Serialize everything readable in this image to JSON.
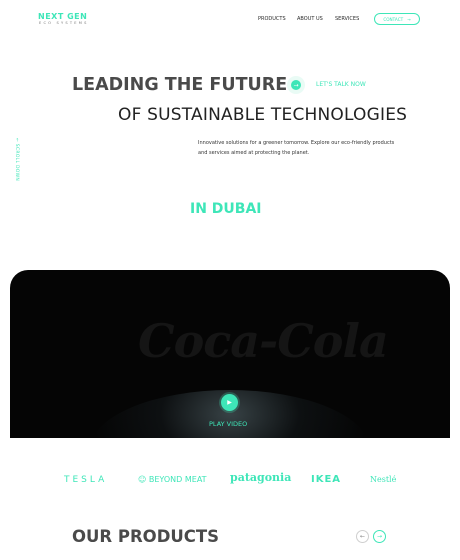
{
  "header": {
    "logo_main": "NEXT GEN",
    "logo_sub": "ECO SYSTEMS",
    "nav": [
      "PRODUCTS",
      "ABOUT US",
      "SERVICES"
    ],
    "contact_label": "CONTACT",
    "contact_icon": "→"
  },
  "hero": {
    "line1": "LEADING THE FUTURE",
    "cta_label": "LET'S TALK NOW",
    "cta_icon": "→",
    "line2": "OF SUSTAINABLE TECHNOLOGIES",
    "description": "Innovative solutions for a greener tomorrow. Explore our eco-friendly products and services aimed at protecting the planet.",
    "scroll_label": "← SCROLL DOWN",
    "location": "IN DUBAI"
  },
  "video": {
    "watermark": "Coca-Cola",
    "play_icon": "▶",
    "play_label": "PLAY VIDEO"
  },
  "brands": [
    "TESLA",
    "BEYOND MEAT",
    "patagonia",
    "IKEA",
    "Nestlé"
  ],
  "brand_icons": {
    "beyond": "☺"
  },
  "products": {
    "title": "OUR PRODUCTS",
    "prev_icon": "←",
    "next_icon": "→"
  },
  "colors": {
    "accent": "#3ee6b8",
    "dark": "#050505",
    "heading": "#4a4a4a"
  }
}
